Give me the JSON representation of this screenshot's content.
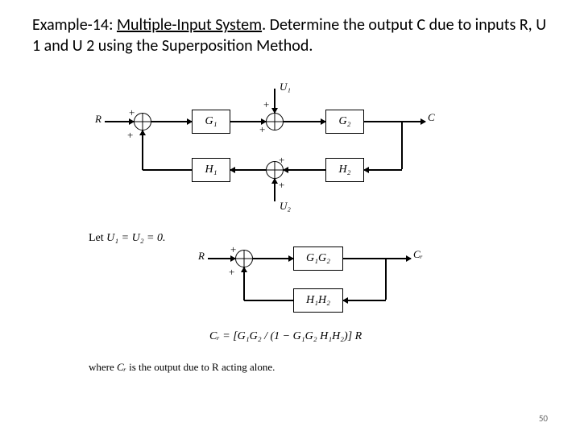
{
  "header": {
    "prefix": "Example-14: ",
    "underlined": "Multiple-Input System",
    "suffix": ". Determine the output C due to inputs R, U 1 and U 2 using the Superposition Method."
  },
  "diagram1": {
    "R": "R",
    "U1": "U₁",
    "U2": "U₂",
    "G1": "G₁",
    "G2": "G₂",
    "H1": "H₁",
    "H2": "H₂",
    "C": "C",
    "plus": "+"
  },
  "step": {
    "let": "Let ",
    "eq": "U₁ = U₂ = 0."
  },
  "diagram2": {
    "R": "R",
    "CR": "Cᵣ",
    "G1G2": "G₁G₂",
    "H1H2": "H₁H₂",
    "plus": "+"
  },
  "result": {
    "formula": "Cᵣ = [G₁G₂ / (1 − G₁G₂ H₁H₂)] R"
  },
  "caption": {
    "where": "where ",
    "cr": "Cᵣ",
    "rest": " is the output due to R acting alone."
  },
  "page": "50"
}
